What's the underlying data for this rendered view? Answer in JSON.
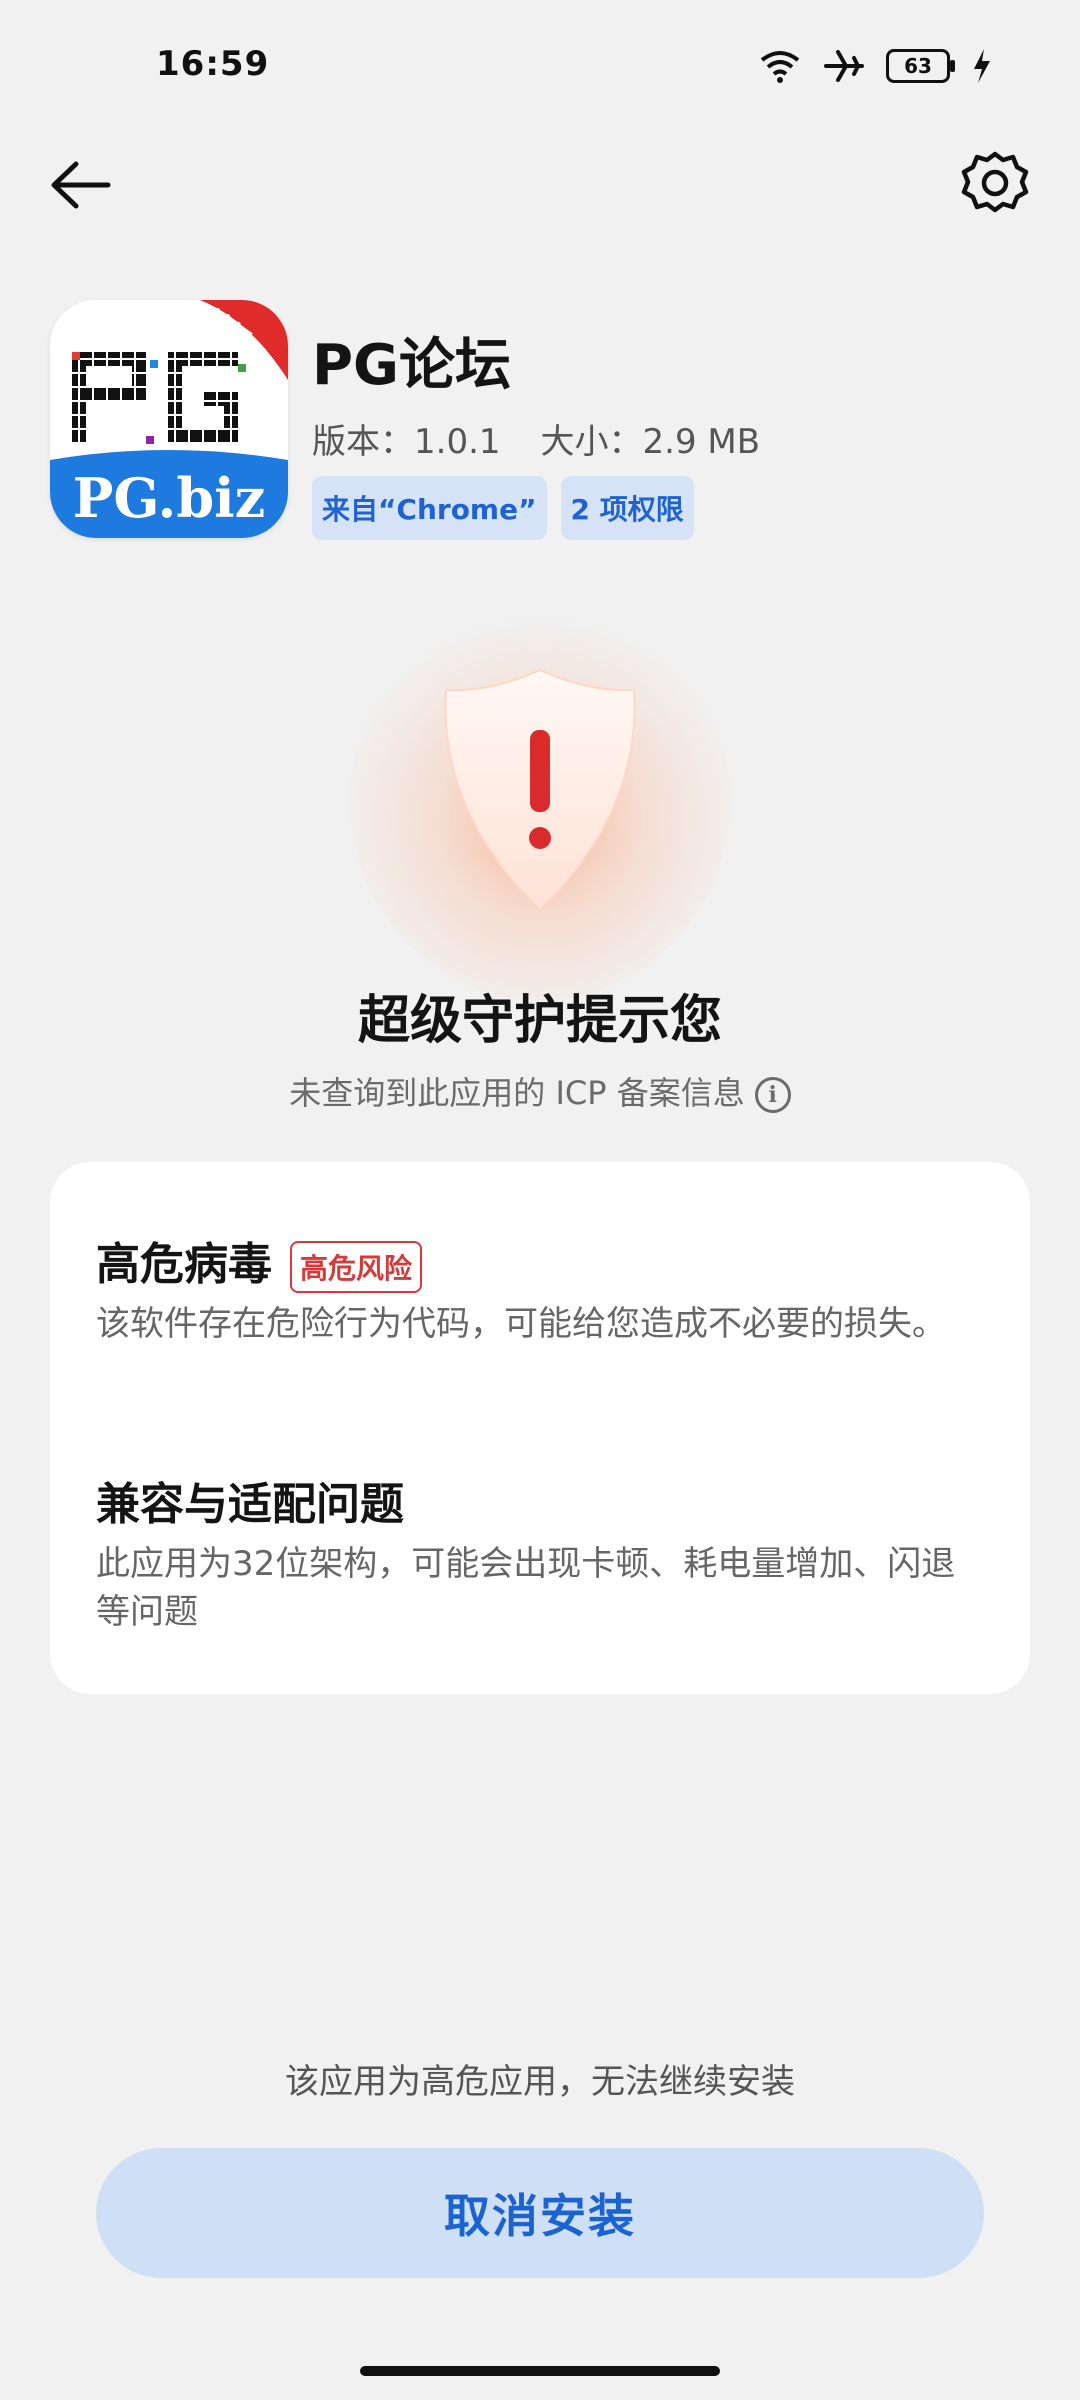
{
  "status_bar": {
    "time": "16:59",
    "battery": "63",
    "icons": [
      "wifi-icon",
      "airplane-icon",
      "battery-icon",
      "charging-icon"
    ]
  },
  "header": {
    "back_icon": "arrow-left-icon",
    "settings_icon": "gear-icon"
  },
  "app": {
    "name": "PG论坛",
    "version": "版本：1.0.1",
    "size": "大小：2.9 MB",
    "source_chip": "来自“Chrome”",
    "permissions_chip": "2 项权限",
    "icon_badge": "论坛",
    "icon_text": "PG.biz"
  },
  "warning": {
    "title": "超级守护提示您",
    "subtitle": "未查询到此应用的 ICP 备案信息",
    "info_icon": "i"
  },
  "risks": [
    {
      "title": "高危病毒",
      "tag": "高危风险",
      "description": "该软件存在危险行为代码，可能给您造成不必要的损失。"
    },
    {
      "title": "兼容与适配问题",
      "description": "此应用为32位架构，可能会出现卡顿、耗电量增加、闪退等问题"
    }
  ],
  "footer": {
    "note": "该应用为高危应用，无法继续安装",
    "cancel_label": "取消安装"
  },
  "colors": {
    "accent": "#1c63d2",
    "danger": "#d63b3b",
    "chip_bg": "#d6e3f7",
    "button_bg": "#cfdff5"
  }
}
